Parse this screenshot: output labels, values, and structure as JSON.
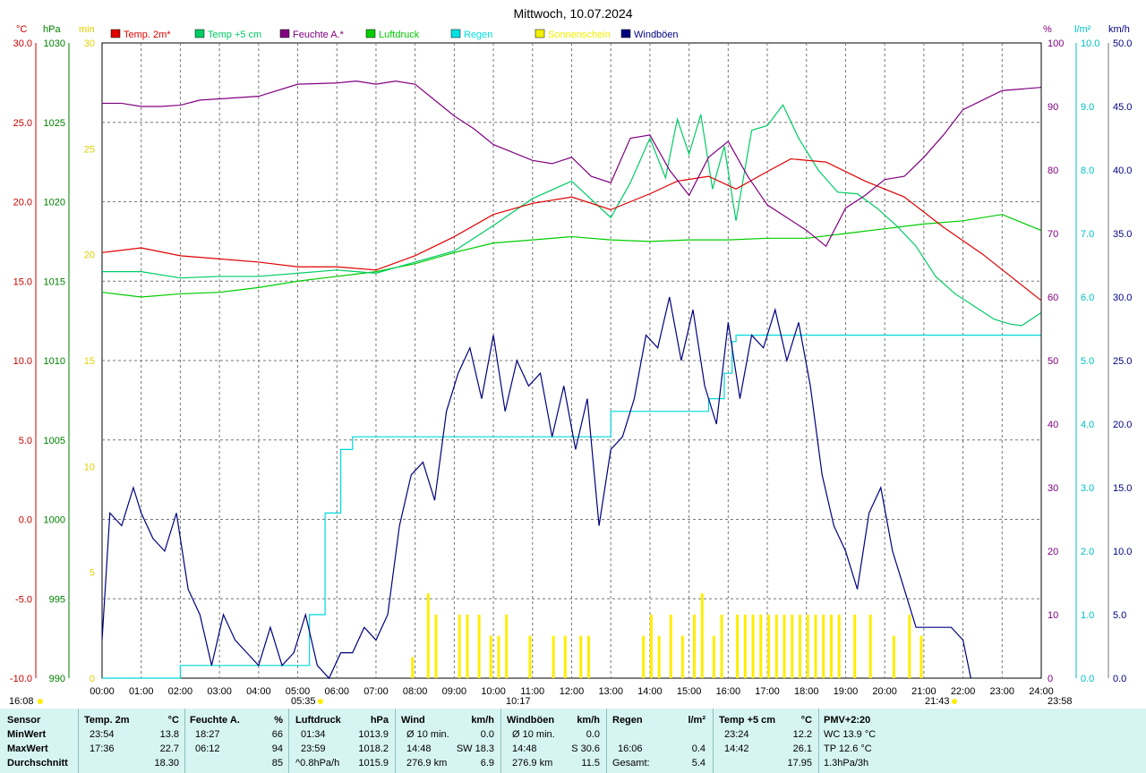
{
  "chart_data": {
    "type": "line",
    "title": "Mittwoch, 10.07.2024",
    "x_ticks": [
      "00:00",
      "01:00",
      "02:00",
      "03:00",
      "04:00",
      "05:00",
      "06:00",
      "07:00",
      "08:00",
      "09:00",
      "10:00",
      "11:00",
      "12:00",
      "13:00",
      "14:00",
      "15:00",
      "16:00",
      "17:00",
      "18:00",
      "19:00",
      "20:00",
      "21:00",
      "22:00",
      "23:00",
      "24:00"
    ],
    "axes": {
      "temp": {
        "unit": "°C",
        "range": [
          -10,
          30
        ],
        "ticks": [
          "30.0",
          "25.0",
          "20.0",
          "15.0",
          "10.0",
          "5.0",
          "0.0",
          "-5.0",
          "-10.0"
        ],
        "color": "#cc0000"
      },
      "pressure": {
        "unit": "hPa",
        "range": [
          990,
          1030
        ],
        "ticks": [
          "1030",
          "1025",
          "1020",
          "1015",
          "1010",
          "1005",
          "1000",
          "995",
          "990"
        ],
        "color": "#008000"
      },
      "sun": {
        "unit": "min",
        "range": [
          0,
          30
        ],
        "ticks": [
          "30",
          "25",
          "20",
          "15",
          "10",
          "5",
          "0"
        ],
        "color": "#e0d000"
      },
      "humidity": {
        "unit": "%",
        "range": [
          0,
          100
        ],
        "ticks": [
          "100",
          "90",
          "80",
          "70",
          "60",
          "50",
          "40",
          "30",
          "20",
          "10",
          "0"
        ],
        "color": "#800080"
      },
      "rain": {
        "unit": "l/m²",
        "range": [
          0,
          10
        ],
        "ticks": [
          "10.0",
          "9.0",
          "8.0",
          "7.0",
          "6.0",
          "5.0",
          "4.0",
          "3.0",
          "2.0",
          "1.0",
          "0.0"
        ],
        "color": "#00c0c0"
      },
      "wind": {
        "unit": "km/h",
        "range": [
          0,
          50
        ],
        "ticks": [
          "50.0",
          "45.0",
          "40.0",
          "35.0",
          "30.0",
          "25.0",
          "20.0",
          "15.0",
          "10.0",
          "5.0",
          "0.0"
        ],
        "color": "#000080"
      }
    },
    "legend": [
      {
        "name": "Temp. 2m*",
        "color": "#e00000"
      },
      {
        "name": "Temp +5 cm",
        "color": "#00cc66"
      },
      {
        "name": "Feuchte A.*",
        "color": "#800080"
      },
      {
        "name": "Luftdruck",
        "color": "#00cc00"
      },
      {
        "name": "Regen",
        "color": "#00e0e0"
      },
      {
        "name": "Sonnenschein",
        "color": "#f0f000"
      },
      {
        "name": "Windböen",
        "color": "#000080"
      }
    ],
    "series": {
      "temp2m": {
        "x": [
          0,
          1,
          2,
          3,
          4,
          5,
          6,
          7,
          8,
          9,
          10,
          11,
          12,
          13,
          14,
          14.7,
          15.5,
          16.2,
          17,
          17.6,
          18.5,
          19.5,
          20.5,
          21.5,
          22.5,
          23.99
        ],
        "y": [
          16.8,
          17.1,
          16.6,
          16.4,
          16.2,
          15.9,
          15.9,
          15.7,
          16.6,
          17.8,
          19.2,
          19.9,
          20.3,
          19.5,
          20.5,
          21.3,
          21.6,
          20.8,
          21.9,
          22.7,
          22.5,
          21.3,
          20.3,
          18.4,
          16.7,
          13.8
        ]
      },
      "temp5cm": {
        "x": [
          0,
          1,
          2,
          3,
          4,
          5,
          6,
          7,
          8,
          9,
          10,
          11,
          12,
          13,
          13.5,
          14,
          14.4,
          14.7,
          15,
          15.3,
          15.6,
          15.9,
          16.2,
          16.6,
          17,
          17.4,
          17.8,
          18.3,
          18.8,
          19.3,
          19.8,
          20.3,
          20.8,
          21.3,
          21.8,
          22.3,
          22.8,
          23.2,
          23.5,
          23.99
        ],
        "y": [
          15.6,
          15.6,
          15.2,
          15.3,
          15.3,
          15.5,
          15.7,
          15.5,
          16.2,
          16.9,
          18.5,
          20.2,
          21.3,
          19.0,
          21.2,
          24.0,
          21.5,
          25.2,
          23.0,
          25.5,
          20.8,
          23.5,
          18.8,
          24.5,
          24.8,
          26.1,
          24.0,
          22.0,
          20.6,
          20.5,
          19.6,
          18.5,
          17.2,
          15.3,
          14.2,
          13.4,
          12.6,
          12.3,
          12.2,
          13.0
        ]
      },
      "humidity": {
        "x": [
          0,
          0.5,
          1,
          1.5,
          2,
          2.5,
          3,
          4,
          5,
          6,
          6.5,
          7,
          7.5,
          8,
          8.5,
          9,
          9.5,
          10,
          11,
          11.5,
          12,
          12.5,
          13,
          13.5,
          14,
          14.5,
          15,
          15.5,
          16,
          16.5,
          17,
          17.5,
          18,
          18.5,
          19,
          19.5,
          20,
          20.5,
          21,
          21.5,
          22,
          22.5,
          23,
          23.99
        ],
        "y": [
          90.5,
          90.5,
          90,
          90,
          90.2,
          91,
          91.2,
          91.6,
          93.5,
          93.7,
          94,
          93.5,
          94,
          93.5,
          91,
          88.5,
          86.5,
          84,
          81.5,
          81,
          82,
          79,
          78,
          85,
          85.5,
          80,
          76,
          82,
          84.5,
          79,
          74.5,
          72.5,
          70.5,
          68,
          74,
          76,
          78.5,
          79,
          82,
          85.5,
          89.5,
          91,
          92.5,
          93
        ]
      },
      "pressure": {
        "x": [
          0,
          1,
          2,
          3,
          4,
          5,
          6,
          7,
          8,
          9,
          10,
          11,
          12,
          13,
          14,
          15,
          16,
          17,
          18,
          19,
          20,
          21,
          22,
          23,
          23.99
        ],
        "y": [
          1014.3,
          1014.0,
          1014.2,
          1014.3,
          1014.6,
          1015.0,
          1015.3,
          1015.6,
          1016.1,
          1016.8,
          1017.4,
          1017.6,
          1017.8,
          1017.6,
          1017.5,
          1017.6,
          1017.6,
          1017.7,
          1017.7,
          1018.0,
          1018.3,
          1018.6,
          1018.8,
          1019.2,
          1018.2
        ]
      },
      "rain_cum": {
        "x": [
          0,
          2,
          4.9,
          5.3,
          5.7,
          6.1,
          6.4,
          9,
          10,
          11,
          12.2,
          12.5,
          13,
          14,
          15,
          15.5,
          15.9,
          16.1,
          16.2,
          17,
          18,
          19,
          20,
          21,
          22,
          23,
          23.99
        ],
        "y": [
          0,
          0.2,
          0.2,
          1.0,
          2.6,
          3.6,
          3.8,
          3.8,
          3.8,
          3.8,
          3.8,
          3.8,
          4.2,
          4.2,
          4.2,
          4.4,
          4.8,
          5.3,
          5.4,
          5.4,
          5.4,
          5.4,
          5.4,
          5.4,
          5.4,
          5.4,
          5.4
        ]
      },
      "sunshine": {
        "x": [
          7.9,
          8.3,
          8.5,
          9.1,
          9.3,
          9.6,
          9.9,
          10.1,
          10.3,
          10.9,
          11.5,
          11.8,
          12.2,
          12.4,
          13.8,
          14.0,
          14.2,
          14.5,
          14.8,
          15.1,
          15.3,
          15.6,
          15.8,
          16.2,
          16.4,
          16.6,
          16.8,
          17.0,
          17.2,
          17.4,
          17.6,
          17.8,
          18.0,
          18.2,
          18.4,
          18.6,
          18.8,
          19.2,
          19.6,
          20.2,
          20.6,
          20.9
        ],
        "y": [
          1,
          4,
          3,
          3,
          3,
          3,
          2,
          2,
          3,
          2,
          2,
          2,
          2,
          2,
          2,
          3,
          2,
          3,
          2,
          3,
          4,
          2,
          3,
          3,
          3,
          3,
          3,
          3,
          3,
          3,
          3,
          3,
          3,
          3,
          3,
          3,
          3,
          3,
          3,
          2,
          3,
          2
        ]
      },
      "wind_gust": {
        "x": [
          0,
          0.2,
          0.5,
          0.8,
          1,
          1.3,
          1.6,
          1.9,
          2.2,
          2.5,
          2.8,
          3.1,
          3.4,
          3.7,
          4,
          4.3,
          4.6,
          4.9,
          5.2,
          5.5,
          5.8,
          6.1,
          6.4,
          6.7,
          7,
          7.3,
          7.6,
          7.9,
          8.2,
          8.5,
          8.8,
          9.1,
          9.4,
          9.7,
          10,
          10.3,
          10.6,
          10.9,
          11.2,
          11.5,
          11.8,
          12.1,
          12.4,
          12.7,
          13,
          13.3,
          13.6,
          13.9,
          14.2,
          14.5,
          14.8,
          15.1,
          15.4,
          15.7,
          16,
          16.3,
          16.6,
          16.9,
          17.2,
          17.5,
          17.8,
          18.1,
          18.4,
          18.7,
          19,
          19.3,
          19.6,
          19.9,
          20.2,
          20.5,
          20.8,
          21.1,
          21.4,
          21.7,
          22,
          22.2
        ],
        "y": [
          3,
          13,
          12,
          15,
          13,
          11,
          10,
          13,
          7,
          5,
          1,
          5,
          3,
          2,
          1,
          4,
          1,
          2,
          5,
          1,
          0,
          2,
          2,
          4,
          3,
          5,
          12,
          16,
          17,
          14,
          21,
          24,
          26,
          22,
          27,
          21,
          25,
          23,
          24,
          19,
          23,
          18,
          22,
          12,
          18,
          19,
          22,
          27,
          26,
          30,
          25,
          29,
          23,
          20,
          28,
          22,
          27,
          26,
          29,
          25,
          28,
          23,
          16,
          12,
          10,
          7,
          13,
          15,
          10,
          7,
          4,
          4,
          4,
          4,
          3,
          0
        ]
      }
    }
  },
  "bottom_marks": {
    "left_time": "16:08",
    "sunrise": "05:35",
    "noon": "10:17",
    "sunset": "21:43",
    "end_time": "23:58"
  },
  "stats": {
    "rowlabels": {
      "header": "Sensor",
      "min": "MinWert",
      "max": "MaxWert",
      "avg": "Durchschnitt"
    },
    "temp2m": {
      "title": "Temp. 2m",
      "unit": "°C",
      "min_t": "23:54",
      "min_v": "13.8",
      "max_t": "17:36",
      "max_v": "22.7",
      "avg": "18.30"
    },
    "humidity": {
      "title": "Feuchte A.",
      "unit": "%",
      "min_t": "18:27",
      "min_v": "66",
      "max_t": "06:12",
      "max_v": "94",
      "avg": "85"
    },
    "pressure": {
      "title": "Luftdruck",
      "unit": "hPa",
      "min_t": "01:34",
      "min_v": "1013.9",
      "max_t": "23:59",
      "max_v": "1018.2",
      "avg_note": "^0.8hPa/h",
      "avg": "1015.9"
    },
    "wind": {
      "title": "Wind",
      "unit": "km/h",
      "r1a": "Ø 10 min.",
      "r1b": "0.0",
      "r2a": "14:48",
      "r2b": "SW 18.3",
      "r3a": "276.9 km",
      "r3b": "6.9"
    },
    "gusts": {
      "title": "Windböen",
      "unit": "km/h",
      "r1a": "Ø 10 min.",
      "r1b": "0.0",
      "r2a": "14:48",
      "r2b": "S 30.6",
      "r3a": "276.9 km",
      "r3b": "11.5"
    },
    "rain": {
      "title": "Regen",
      "unit": "l/m²",
      "r2a": "16:06",
      "r2b": "0.4",
      "r3a": "Gesamt:",
      "r3b": "5.4"
    },
    "temp5cm": {
      "title": "Temp +5 cm",
      "unit": "°C",
      "min_t": "23:24",
      "min_v": "12.2",
      "max_t": "14:42",
      "max_v": "26.1",
      "avg": "17.95"
    },
    "pmv": {
      "title": "PMV+2:20",
      "l1": "WC 13.9 °C",
      "l2": "TP 12.6 °C",
      "l3": "1.3hPa/3h"
    }
  }
}
